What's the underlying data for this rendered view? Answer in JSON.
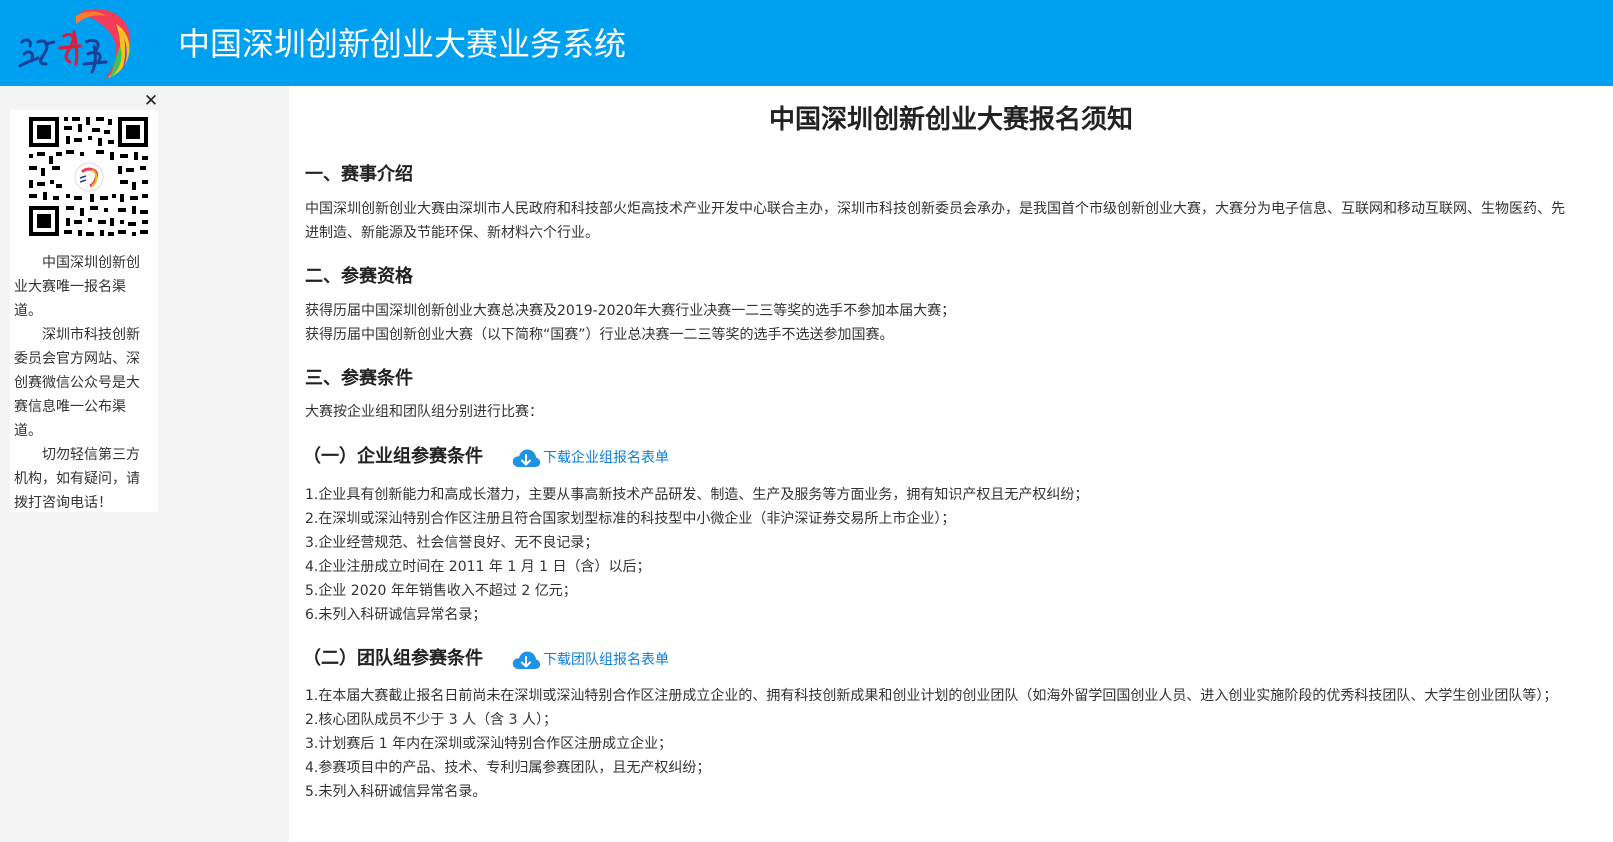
{
  "header": {
    "title": "中国深圳创新创业大赛业务系统",
    "bg_color": "#00a0f0",
    "logo_alt": "深创赛 logo"
  },
  "side_panel": {
    "close_glyph": "✕",
    "paragraphs": [
      "中国深圳创新创业大赛唯一报名渠道。",
      "深圳市科技创新委员会官方网站、深创赛微信公众号是大赛信息唯一公布渠道。",
      "切勿轻信第三方机构，如有疑问，请拨打咨询电话！"
    ]
  },
  "main": {
    "title": "中国深圳创新创业大赛报名须知",
    "sections": {
      "intro": {
        "heading": "一、赛事介绍",
        "text": "中国深圳创新创业大赛由深圳市人民政府和科技部火炬高技术产业开发中心联合主办，深圳市科技创新委员会承办，是我国首个市级创新创业大赛，大赛分为电子信息、互联网和移动互联网、生物医药、先进制造、新能源及节能环保、新材料六个行业。"
      },
      "qualification": {
        "heading": "二、参赛资格",
        "lines": [
          "获得历届中国深圳创新创业大赛总决赛及2019-2020年大赛行业决赛一二三等奖的选手不参加本届大赛；",
          "获得历届中国创新创业大赛（以下简称“国赛”）行业总决赛一二三等奖的选手不选送参加国赛。"
        ]
      },
      "conditions": {
        "heading": "三、参赛条件",
        "text": "大赛按企业组和团队组分别进行比赛：",
        "enterprise": {
          "heading": "（一）企业组参赛条件",
          "download_label": "下载企业组报名表单",
          "items": [
            "1.企业具有创新能力和高成长潜力，主要从事高新技术产品研发、制造、生产及服务等方面业务，拥有知识产权且无产权纠纷；",
            "2.在深圳或深汕特别合作区注册且符合国家划型标准的科技型中小微企业（非沪深证券交易所上市企业）；",
            "3.企业经营规范、社会信誉良好、无不良记录；",
            "4.企业注册成立时间在 2011 年 1 月 1 日（含）以后；",
            "5.企业 2020 年年销售收入不超过 2 亿元；",
            "6.未列入科研诚信异常名录；"
          ]
        },
        "team": {
          "heading": "（二）团队组参赛条件",
          "download_label": "下载团队组报名表单",
          "items": [
            "1.在本届大赛截止报名日前尚未在深圳或深汕特别合作区注册成立企业的、拥有科技创新成果和创业计划的创业团队（如海外留学回国创业人员、进入创业实施阶段的优秀科技团队、大学生创业团队等）；",
            "2.核心团队成员不少于 3 人（含 3 人）；",
            "3.计划赛后 1 年内在深圳或深汕特别合作区注册成立企业；",
            "4.参赛项目中的产品、技术、专利归属参赛团队，且无产权纠纷；",
            "5.未列入科研诚信异常名录。"
          ]
        }
      }
    }
  },
  "colors": {
    "accent": "#00a0f0",
    "link": "#0a7fd8",
    "panel_bg": "#ffffff",
    "page_bg": "#f4f4f4"
  },
  "icons": {
    "close": "close-icon",
    "download": "cloud-download-icon",
    "qr": "qr-code-icon"
  }
}
